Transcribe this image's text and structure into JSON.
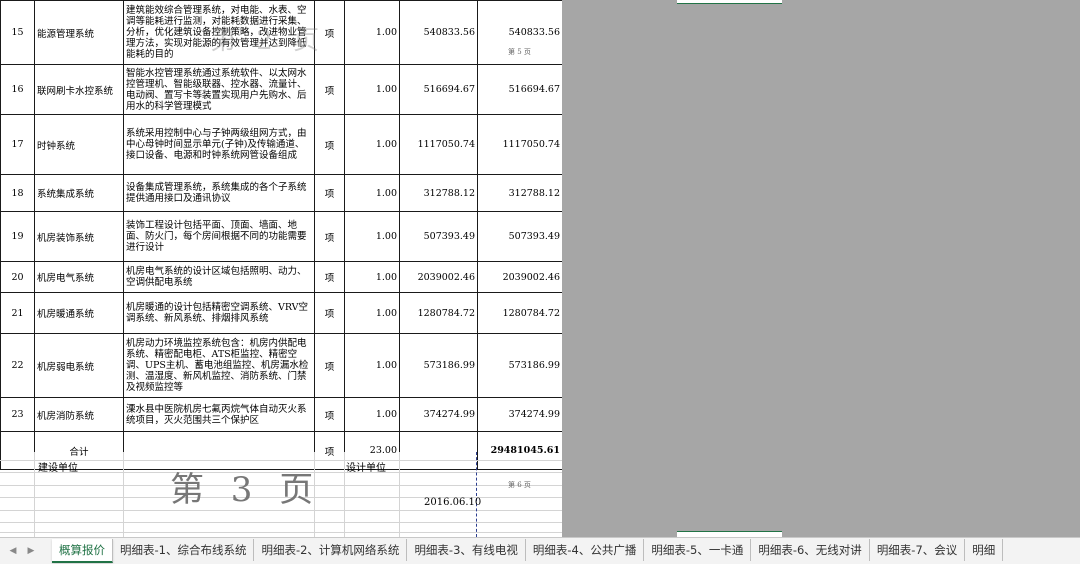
{
  "rows": [
    {
      "no": "15",
      "name": "能源管理系统",
      "desc": "建筑能效综合管理系统，对电能、水表、空调等能耗进行监测，对能耗数据进行采集、分析，优化建筑设备控制策略，改进物业管理方法，实现对能源的有效管理并达到降低能耗的目的",
      "unit": "项",
      "qty": "1.00",
      "price": "540833.56",
      "total": "540833.56"
    },
    {
      "no": "16",
      "name": "联网刷卡水控系统",
      "desc": "智能水控管理系统通过系统软件、以太网水控管理机、智能级联器、控水器、流量计、电动阀、置写卡等装置实现用户先购水、后用水的科学管理模式",
      "unit": "项",
      "qty": "1.00",
      "price": "516694.67",
      "total": "516694.67"
    },
    {
      "no": "17",
      "name": "时钟系统",
      "desc": "系统采用控制中心与子钟两级组网方式，由中心母钟时间显示单元(子钟)及传输通道、接口设备、电源和时钟系统网管设备组成",
      "unit": "项",
      "qty": "1.00",
      "price": "1117050.74",
      "total": "1117050.74"
    },
    {
      "no": "18",
      "name": "系统集成系统",
      "desc": "设备集成管理系统，系统集成的各个子系统提供通用接口及通讯协议",
      "unit": "项",
      "qty": "1.00",
      "price": "312788.12",
      "total": "312788.12"
    },
    {
      "no": "19",
      "name": "机房装饰系统",
      "desc": "装饰工程设计包括平面、顶面、墙面、地面、防火门，每个房间根据不同的功能需要进行设计",
      "unit": "项",
      "qty": "1.00",
      "price": "507393.49",
      "total": "507393.49"
    },
    {
      "no": "20",
      "name": "机房电气系统",
      "desc": "机房电气系统的设计区域包括照明、动力、空调供配电系统",
      "unit": "项",
      "qty": "1.00",
      "price": "2039002.46",
      "total": "2039002.46"
    },
    {
      "no": "21",
      "name": "机房暖通系统",
      "desc": "机房暖通的设计包括精密空调系统、VRV空调系统、新风系统、排烟排风系统",
      "unit": "项",
      "qty": "1.00",
      "price": "1280784.72",
      "total": "1280784.72"
    },
    {
      "no": "22",
      "name": "机房弱电系统",
      "desc": "机房动力环境监控系统包含：机房内供配电系统、精密配电柜、ATS柜监控、精密空调、UPS主机、蓄电池组监控、机房漏水检测、温湿度、新风机监控、消防系统、门禁及视频监控等",
      "unit": "项",
      "qty": "1.00",
      "price": "573186.99",
      "total": "573186.99"
    },
    {
      "no": "23",
      "name": "机房消防系统",
      "desc": "溧水县中医院机房七氟丙烷气体自动灭火系统项目，灭火范围共三个保护区",
      "unit": "项",
      "qty": "1.00",
      "price": "374274.99",
      "total": "374274.99"
    }
  ],
  "summary": {
    "label": "合计",
    "unit": "项",
    "qty": "23.00",
    "total": "29481045.61"
  },
  "footer": {
    "build_unit": "建设单位",
    "design_unit": "设计单位",
    "date": "2016.06.10"
  },
  "watermarks": {
    "page3": "第 3 页",
    "page2": "第 2 页",
    "page5_small": "第 5 页",
    "page6_small": "第 6 页"
  },
  "tabs": [
    "概算报价",
    "明细表-1、综合布线系统",
    "明细表-2、计算机网络系统",
    "明细表-3、有线电视",
    "明细表-4、公共广播",
    "明细表-5、一卡通",
    "明细表-6、无线对讲",
    "明细表-7、会议",
    "明细"
  ],
  "nav": {
    "prev": "◀",
    "next": "▶"
  }
}
